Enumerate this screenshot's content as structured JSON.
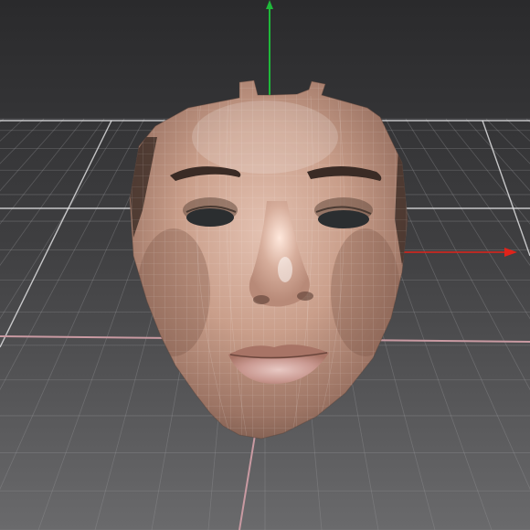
{
  "viewport": {
    "type": "3d-viewport",
    "scene": "textured-face-scan-mesh",
    "background_top": "#2a2a2c",
    "background_bottom": "#6a6a6c",
    "grid_color": "#9a9a9e",
    "grid_major_color": "#e8e8ea",
    "grid_axis_color": "#c99aa2",
    "y_axis_color": "#1fb83a",
    "x_axis_color": "#e0231a",
    "skin_color": "#c99e8a",
    "wireframe_color": "#ffffff"
  }
}
